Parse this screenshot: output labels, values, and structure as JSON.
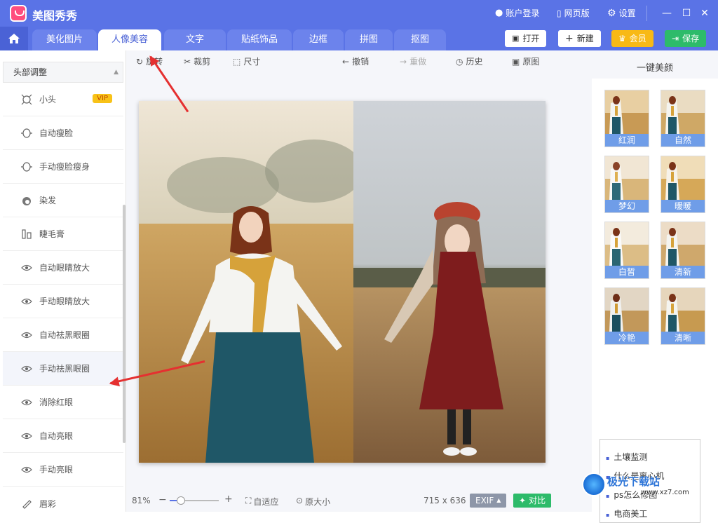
{
  "app": {
    "name": "美图秀秀"
  },
  "titlebar": {
    "login": "账户登录",
    "web": "网页版",
    "settings": "设置"
  },
  "tabs": [
    {
      "label": "美化图片"
    },
    {
      "label": "人像美容"
    },
    {
      "label": "文字"
    },
    {
      "label": "贴纸饰品"
    },
    {
      "label": "边框"
    },
    {
      "label": "拼图"
    },
    {
      "label": "抠图"
    }
  ],
  "actions": {
    "open": "打开",
    "new": "新建",
    "vip": "会员",
    "save": "保存"
  },
  "left": {
    "section": "头部调整",
    "items": [
      {
        "label": "小头",
        "badge": "VIP"
      },
      {
        "label": "自动瘦脸"
      },
      {
        "label": "手动瘦脸瘦身"
      },
      {
        "label": "染发"
      },
      {
        "label": "睫毛膏"
      },
      {
        "label": "自动眼睛放大"
      },
      {
        "label": "手动眼睛放大"
      },
      {
        "label": "自动祛黑眼圈"
      },
      {
        "label": "手动祛黑眼圈"
      },
      {
        "label": "消除红眼"
      },
      {
        "label": "自动亮眼"
      },
      {
        "label": "手动亮眼"
      },
      {
        "label": "眉彩"
      }
    ]
  },
  "toolbar": {
    "rotate": "旋转",
    "crop": "裁剪",
    "size": "尺寸",
    "undo": "撤销",
    "redo": "重做",
    "history": "历史",
    "original": "原图"
  },
  "status": {
    "zoom": "81%",
    "fit": "自适应",
    "actual": "原大小",
    "dimensions": "715 x 636",
    "exif": "EXIF",
    "compare": "对比"
  },
  "right": {
    "title": "一键美颜",
    "presets": [
      {
        "label": "红润"
      },
      {
        "label": "自然"
      },
      {
        "label": "梦幻"
      },
      {
        "label": "暖暖"
      },
      {
        "label": "白皙"
      },
      {
        "label": "清新"
      },
      {
        "label": "冷艳"
      },
      {
        "label": "清晰"
      }
    ],
    "links": [
      "土壤监测",
      "什么是离心机",
      "ps怎么修图",
      "电商美工"
    ]
  },
  "watermark": {
    "brand": "极光下载站",
    "url": "www.xz7.com"
  },
  "colors": {
    "brand": "#5a73e6",
    "vip": "#f8b916",
    "save": "#2dbb6a",
    "preset_label": "#6f9de8",
    "arrow": "#e53030"
  }
}
